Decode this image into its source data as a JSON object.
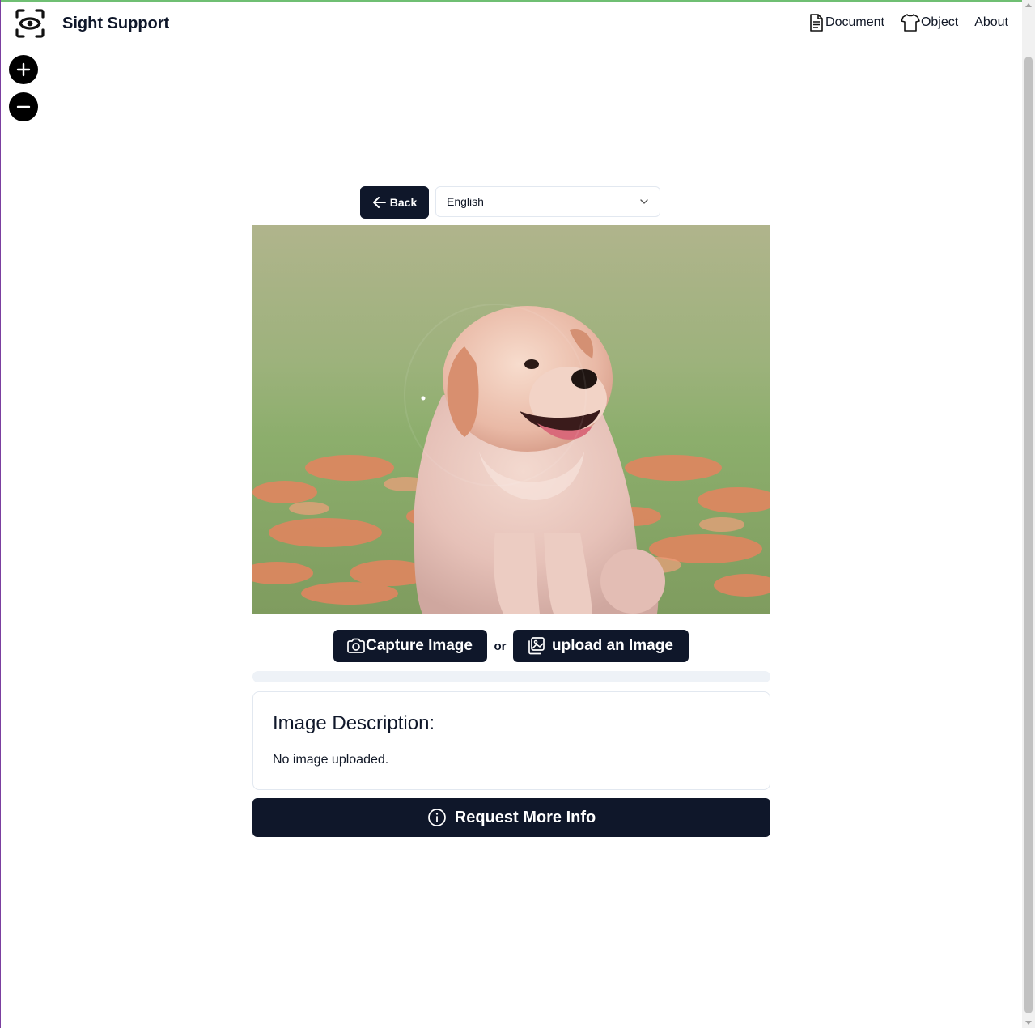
{
  "header": {
    "brand": "Sight Support",
    "nav": [
      {
        "label": "Document",
        "icon": "document-icon"
      },
      {
        "label": "Object",
        "icon": "shirt-icon"
      },
      {
        "label": "About"
      }
    ]
  },
  "zoom": {
    "in_icon": "plus-icon",
    "out_icon": "minus-icon"
  },
  "controls": {
    "back_label": "Back",
    "language_selected": "English"
  },
  "image": {
    "subject": "golden retriever puppy sitting in a field of orange flowers"
  },
  "actions": {
    "capture_label": "Capture Image",
    "or_label": "or",
    "upload_label": "upload an Image"
  },
  "progress": {
    "value_percent": 0
  },
  "description": {
    "title": "Image Description:",
    "text": "No image uploaded."
  },
  "request_button": {
    "label": "Request More Info"
  },
  "colors": {
    "primary": "#0f172a",
    "border": "#e2e8f0",
    "progress_track": "#eef2f7"
  }
}
